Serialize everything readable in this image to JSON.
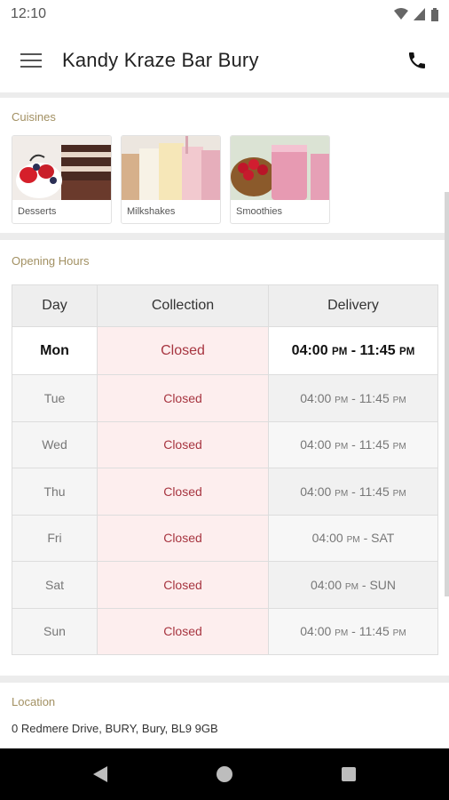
{
  "status_bar": {
    "time": "12:10",
    "icons": [
      "wifi-icon",
      "signal-icon",
      "battery-icon"
    ]
  },
  "header": {
    "title": "Kandy Kraze Bar Bury",
    "menu_icon": "menu-icon",
    "call_icon": "phone-icon"
  },
  "cuisines": {
    "label": "Cuisines",
    "items": [
      {
        "label": "Desserts"
      },
      {
        "label": "Milkshakes"
      },
      {
        "label": "Smoothies"
      }
    ]
  },
  "opening_hours": {
    "label": "Opening Hours",
    "columns": [
      "Day",
      "Collection",
      "Delivery"
    ],
    "rows": [
      {
        "day": "Mon",
        "collection": "Closed",
        "delivery_start": "04:00",
        "start_suffix": "PM",
        "delivery_end": "11:45",
        "end_suffix": "PM"
      },
      {
        "day": "Tue",
        "collection": "Closed",
        "delivery_start": "04:00",
        "start_suffix": "PM",
        "delivery_end": "11:45",
        "end_suffix": "PM"
      },
      {
        "day": "Wed",
        "collection": "Closed",
        "delivery_start": "04:00",
        "start_suffix": "PM",
        "delivery_end": "11:45",
        "end_suffix": "PM"
      },
      {
        "day": "Thu",
        "collection": "Closed",
        "delivery_start": "04:00",
        "start_suffix": "PM",
        "delivery_end": "11:45",
        "end_suffix": "PM"
      },
      {
        "day": "Fri",
        "collection": "Closed",
        "delivery_start": "04:00",
        "start_suffix": "PM",
        "delivery_end": "SAT",
        "end_suffix": ""
      },
      {
        "day": "Sat",
        "collection": "Closed",
        "delivery_start": "04:00",
        "start_suffix": "PM",
        "delivery_end": "SUN",
        "end_suffix": ""
      },
      {
        "day": "Sun",
        "collection": "Closed",
        "delivery_start": "04:00",
        "start_suffix": "PM",
        "delivery_end": "11:45",
        "end_suffix": "PM"
      }
    ],
    "separator": " - "
  },
  "location": {
    "label": "Location",
    "address": "0 Redmere Drive, BURY, Bury, BL9 9GB"
  },
  "nav_bar": {
    "icons": [
      "back-icon",
      "home-icon",
      "recents-icon"
    ]
  },
  "colors": {
    "accent_label": "#a29062",
    "closed_text": "#a73540",
    "closed_bg": "#fdeeee"
  }
}
